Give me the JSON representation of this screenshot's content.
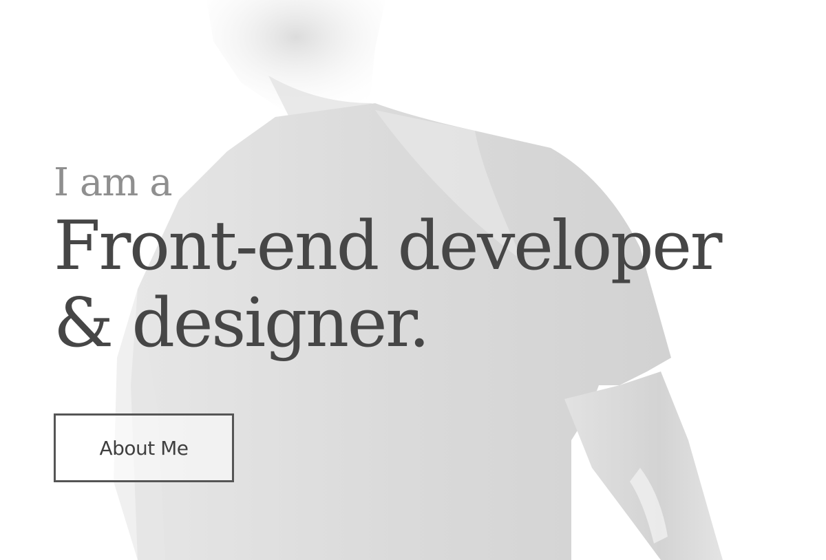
{
  "hero": {
    "intro": "I am a",
    "headline_line1": "Front-end developer",
    "headline_line2": "& designer.",
    "button_label": "About Me"
  },
  "colors": {
    "background": "#ffffff",
    "intro_text": "#8f8f8f",
    "headline_text": "#464646",
    "button_border": "#555555",
    "photo_tint": "#d9d9d9"
  },
  "icons": {
    "background_photo": "person-silhouette"
  }
}
